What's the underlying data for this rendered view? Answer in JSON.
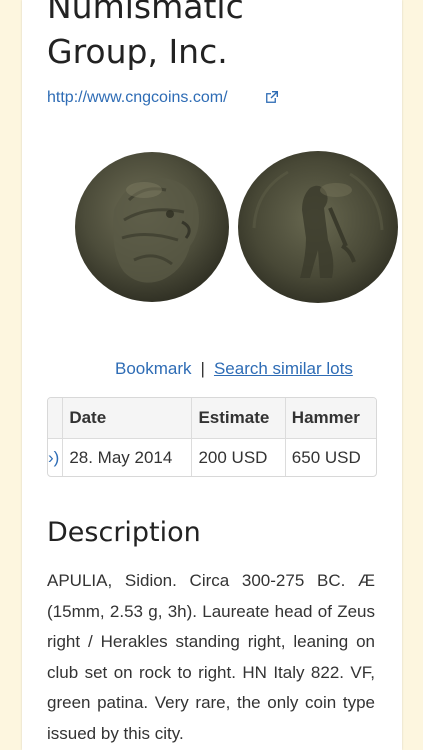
{
  "header": {
    "title_line1": "Numismatic",
    "title_line2": "Group, Inc.",
    "url": "http://www.cngcoins.com/"
  },
  "icons": {
    "external_link": "external-link-icon"
  },
  "coin_images": [
    "obverse-zeus-head",
    "reverse-herakles-standing"
  ],
  "actions": {
    "bookmark": "Bookmark",
    "separator": "|",
    "search_similar": "Search similar lots"
  },
  "sale_table": {
    "columns": [
      "",
      "Date",
      "Estimate",
      "Hammer"
    ],
    "rows": [
      {
        "nav": "›)",
        "date": "28. May 2014",
        "estimate": "200 USD",
        "hammer": "650 USD"
      }
    ]
  },
  "description": {
    "heading": "Description",
    "text": "APULIA, Sidion. Circa 300-275 BC. Æ (15mm, 2.53 g, 3h). Laureate head of Zeus right / Herakles standing right, leaning on club set on rock to right. HN Italy 822. VF, green patina. Very rare, the only coin type issued by this city."
  },
  "colors": {
    "page_background": "#fdf6df",
    "card": "#ffffff",
    "link": "#2e6cb5",
    "text": "#333333"
  }
}
